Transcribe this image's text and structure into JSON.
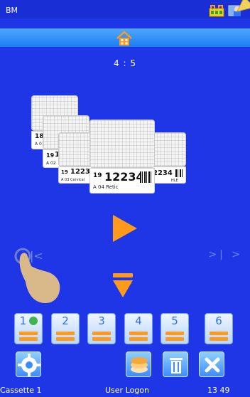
{
  "statusbar": {
    "app_name": "BM"
  },
  "counter": "4 : 5",
  "cassettes": [
    {
      "num": "1",
      "small": "A  01"
    },
    {
      "num": "",
      "small": "A  02"
    },
    {
      "num": "12234",
      "prefix": "19",
      "small": "A  03  Cervical"
    },
    {
      "num": "12234",
      "prefix": "19",
      "small": "A  04  Retic"
    },
    {
      "num": "2234",
      "prefix": "",
      "small": "HLE"
    }
  ],
  "tabs": [
    {
      "label": "1"
    },
    {
      "label": "2"
    },
    {
      "label": "3"
    },
    {
      "label": "4"
    },
    {
      "label": "5"
    },
    {
      "label": "6"
    }
  ],
  "footer": {
    "left": "Cassette 1",
    "middle": "User Logon",
    "right": "13 49"
  },
  "nav": {
    "prev": "|<",
    "next": ">| >"
  },
  "colors": {
    "background": "#1f36e6",
    "accent": "#ff9a1a",
    "tab": "#2d6cff"
  }
}
